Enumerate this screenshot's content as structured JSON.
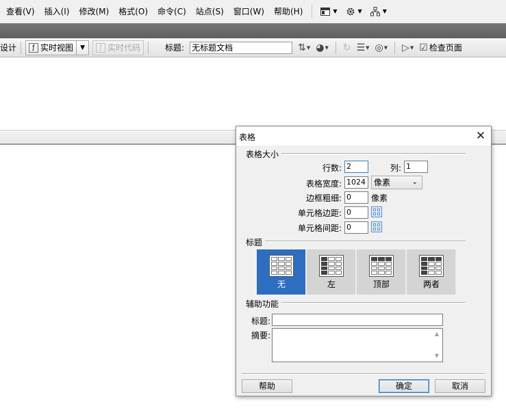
{
  "menubar": {
    "items": [
      "查看(V)",
      "插入(I)",
      "修改(M)",
      "格式(O)",
      "命令(C)",
      "站点(S)",
      "窗口(W)",
      "帮助(H)"
    ]
  },
  "doc_toolbar": {
    "design_label": "设计",
    "live_view_label": "实时视图",
    "live_code_label": "实时代码",
    "title_label": "标题:",
    "title_value": "无标题文档",
    "inspect_label": "检查页面"
  },
  "dialog": {
    "title": "表格",
    "table_size": {
      "group_label": "表格大小",
      "rows_label": "行数:",
      "rows_value": "2",
      "cols_label": "列:",
      "cols_value": "1",
      "width_label": "表格宽度:",
      "width_value": "1024",
      "width_unit": "像素",
      "border_label": "边框粗细:",
      "border_value": "0",
      "border_unit": "像素",
      "padding_label": "单元格边距:",
      "padding_value": "0",
      "spacing_label": "单元格间距:",
      "spacing_value": "0"
    },
    "header": {
      "group_label": "标题",
      "options": [
        {
          "label": "无",
          "selected": true
        },
        {
          "label": "左",
          "selected": false
        },
        {
          "label": "顶部",
          "selected": false
        },
        {
          "label": "两者",
          "selected": false
        }
      ]
    },
    "accessibility": {
      "group_label": "辅助功能",
      "caption_label": "标题:",
      "caption_value": "",
      "summary_label": "摘要:",
      "summary_value": ""
    },
    "buttons": {
      "help": "帮助",
      "ok": "确定",
      "cancel": "取消"
    }
  },
  "colors": {
    "selected_option": "#2e6ec0",
    "dark_strip": "#6a6a6a",
    "dialog_bg": "#f0f0f0"
  }
}
